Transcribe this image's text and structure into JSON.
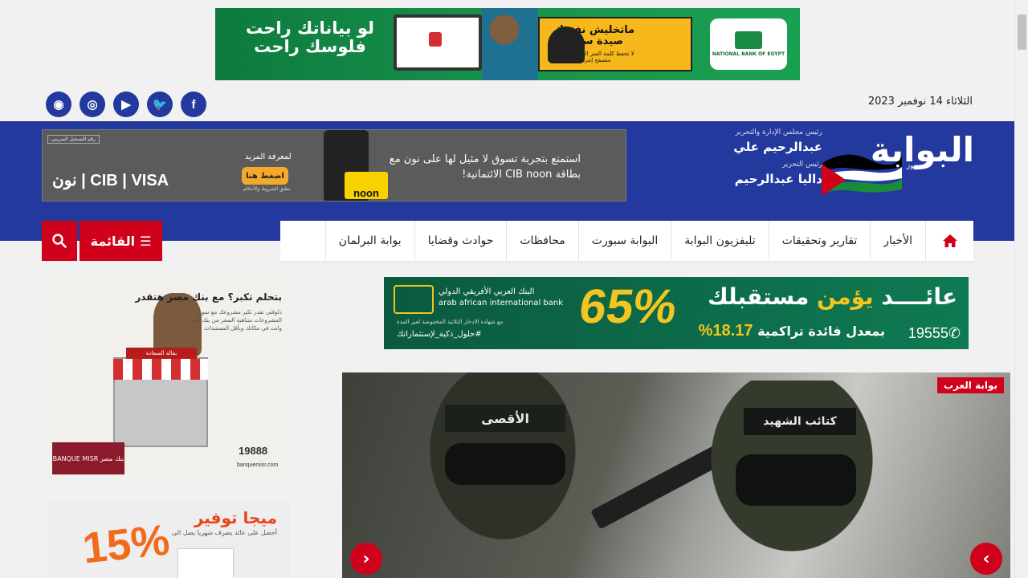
{
  "date": "الثلاثاء 14 نوفمبر 2023",
  "social": [
    {
      "name": "rss-icon",
      "glyph": "◉"
    },
    {
      "name": "instagram-icon",
      "glyph": "◎"
    },
    {
      "name": "youtube-icon",
      "glyph": "▶"
    },
    {
      "name": "twitter-icon",
      "glyph": "🐦"
    },
    {
      "name": "facebook-icon",
      "glyph": "f"
    }
  ],
  "top_ad": {
    "nbe_name": "NATIONAL BANK OF EGYPT",
    "warning": "ماتخليش نفسك صيدة سهلة",
    "warning_sub": "لا تحفظ كلمة السر البنكية على أي متصفح إنترنت",
    "slogan": "لو بياناتك راحت فلوسك راحت"
  },
  "header": {
    "logo": "البوابة",
    "logo_sub": "نيوز",
    "chairman_role": "رئيس مجلس الإدارة والتحرير",
    "chairman_name": "عبدالرحيم علي",
    "editor_role": "رئيس التحرير",
    "editor_name": "داليا عبدالرحيم"
  },
  "header_ad": {
    "registration": "رقم التسجيل الضريبي",
    "message": "استمتع بتجربة تسوق لا مثيل لها على نون مع بطاقة CIB noon الائتمانية!",
    "more": "لمعرفة المزيد",
    "cta": "اضغط هنا",
    "terms": "تطبق الشروط والأحكام",
    "brands": "CIB | VISA | نون",
    "card_label": "noon"
  },
  "nav": {
    "items": [
      "الأخبار",
      "تقارير وتحقيقات",
      "تليفزيون البوابة",
      "البوابة سبورت",
      "محافظات",
      "حوادث وقضايا",
      "بوابة البرلمان"
    ],
    "menu_label": "القائمة"
  },
  "mid_ad": {
    "headline_part1": "عائــــد",
    "headline_hl": "يؤمن",
    "headline_part2": "مستقبلك",
    "rate_text": "بمعدل فائدة تراكمية",
    "rate": "18.17%",
    "hotline": "19555",
    "big": "65%",
    "bank_ar": "البنك العربي الأفريقي الدولي",
    "bank_en": "arab african international bank",
    "certificate": "مع شهادة الادخار الثلاثية المخفوضة لغير المدة",
    "tagline": "#حلول_ذكية_لإستثماراتك"
  },
  "side_ad1": {
    "title": "بتحلم تكبر؟ مع بنك مصر هتقدر",
    "sub": "دلوقتي تقدر تكبر مشروعك مع تمويل المشروعات متناهية الصغر من بنك مصر وانت في مكانك وبأقل المستندات",
    "shop_sign": "بقالة السعادة",
    "hotline": "19888",
    "url": "banquemisr.com",
    "bank": "بنك مصر BANQUE MISR"
  },
  "side_ad2": {
    "title": "ميجا توفير",
    "sub": "أحصل على عائد يصرف شهريا يصل الى",
    "pct": "15%"
  },
  "slider": {
    "category": "بوابة العرب",
    "band1": "الأقصى",
    "band2": "كتائب الشهيد",
    "prev": "‹",
    "next": "›"
  }
}
